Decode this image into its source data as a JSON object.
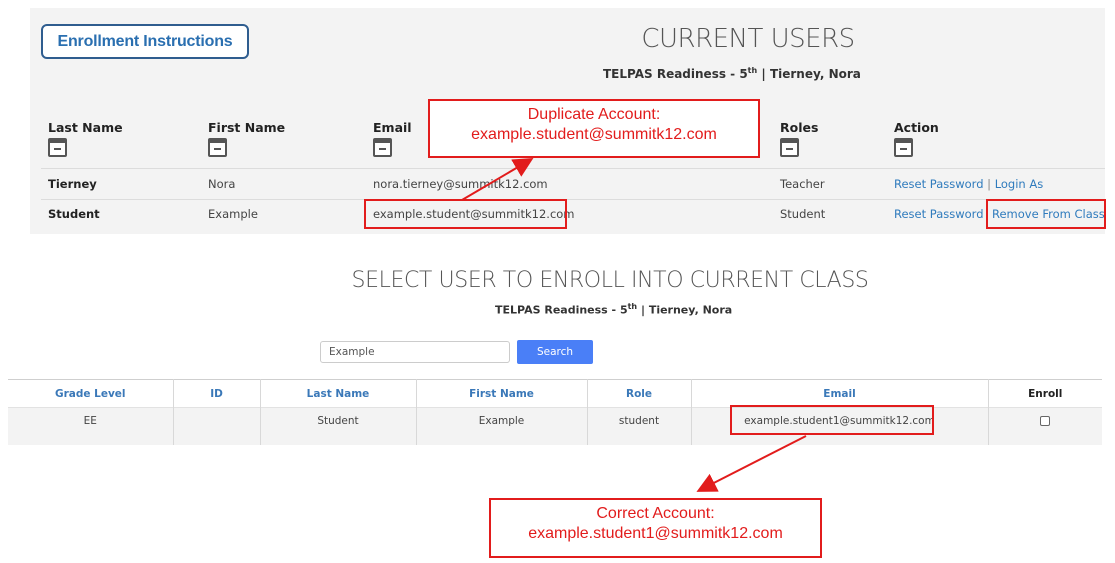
{
  "enrollment_instructions_label": "Enrollment Instructions",
  "current_users": {
    "title": "CURRENT USERS",
    "subtitle_main": "TELPAS Readiness - 5",
    "subtitle_sup": "th",
    "subtitle_rest": " | Tierney, Nora",
    "columns": {
      "last_name": "Last Name",
      "first_name": "First Name",
      "email": "Email",
      "roles": "Roles",
      "action": "Action"
    },
    "rows": [
      {
        "last_name": "Tierney",
        "first_name": "Nora",
        "email": "nora.tierney@summitk12.com",
        "role": "Teacher",
        "action1": "Reset Password",
        "separator": "|",
        "action2": "Login As"
      },
      {
        "last_name": "Student",
        "first_name": "Example",
        "email": "example.student@summitk12.com",
        "role": "Student",
        "action1": "Reset Password",
        "separator": "",
        "action2": "Remove From Class"
      }
    ]
  },
  "select_user": {
    "title": "SELECT USER TO ENROLL INTO CURRENT CLASS",
    "subtitle_main": "TELPAS Readiness - 5",
    "subtitle_sup": "th",
    "subtitle_rest": " | Tierney, Nora",
    "search_value": "Example",
    "search_button": "Search",
    "columns": [
      "Grade Level",
      "ID",
      "Last Name",
      "First Name",
      "Role",
      "Email",
      "Enroll"
    ],
    "rows": [
      {
        "grade_level": "EE",
        "id": "",
        "last_name": "Student",
        "first_name": "Example",
        "role": "student",
        "email": "example.student1@summitk12.com",
        "enroll_checked": false
      }
    ]
  },
  "annotations": {
    "duplicate_title": "Duplicate Account:",
    "duplicate_email": "example.student@summitk12.com",
    "correct_title": "Correct Account:",
    "correct_email": "example.student1@summitk12.com",
    "highlight_color": "#e21c1c"
  },
  "colors": {
    "link": "#2f7bbd",
    "header_link": "#3a78b8",
    "search_button": "#4a7ff7",
    "panel_bg": "#f3f3f3"
  }
}
